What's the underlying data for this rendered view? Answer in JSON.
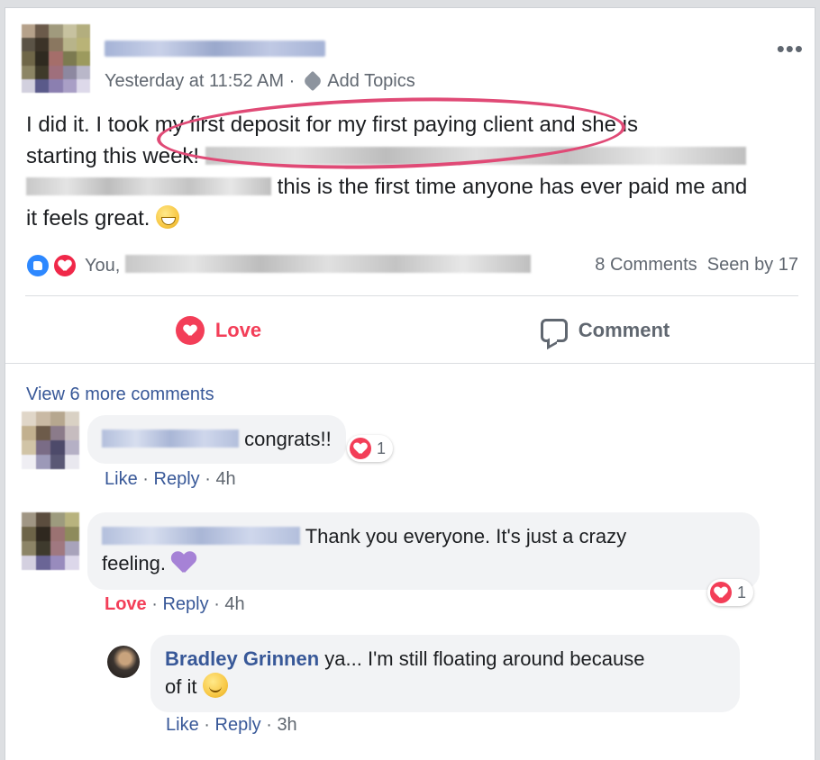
{
  "post": {
    "timestamp": "Yesterday at 11:52 AM",
    "separator": "·",
    "add_topics": "Add Topics",
    "more_menu": "•••",
    "text_line1": "I did it. I took my first deposit for my first paying client and she is",
    "text_line2": "starting this week!",
    "text_line3": "this is the first time anyone has ever paid me and",
    "text_line4": "it feels great.",
    "highlight_color": "#e04a76"
  },
  "reactions": {
    "names_prefix": "You,",
    "comments_count": "8 Comments",
    "seen_by": "Seen by 17",
    "icons": [
      "like-icon",
      "love-icon"
    ]
  },
  "actions": {
    "love_label": "Love",
    "comment_label": "Comment"
  },
  "comments": {
    "view_more": "View 6 more comments",
    "items": [
      {
        "text": "congrats!!",
        "like": "Like",
        "reply": "Reply",
        "time": "4h",
        "reaction_count": "1",
        "dot": "·"
      },
      {
        "text_line1": "Thank you everyone. It's just a crazy",
        "text_line2": "feeling.",
        "love": "Love",
        "reply": "Reply",
        "time": "4h",
        "reaction_count": "1",
        "dot": "·"
      },
      {
        "author": "Bradley Grinnen",
        "text_line1": "ya... I'm still floating around because",
        "text_line2": "of it",
        "like": "Like",
        "reply": "Reply",
        "time": "3h",
        "dot": "·"
      }
    ]
  },
  "colors": {
    "link": "#385898",
    "love": "#f33e58",
    "like_blue": "#2d88ff",
    "bubble": "#f2f3f5"
  }
}
